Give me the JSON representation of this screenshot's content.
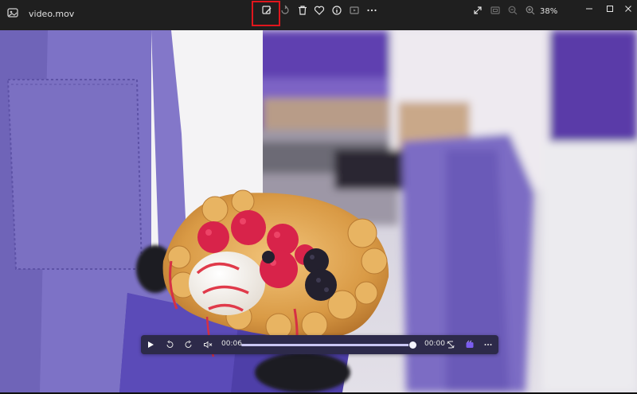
{
  "window": {
    "title": "video.mov",
    "zoom_level": "38%"
  },
  "toolbar": {
    "items": [
      {
        "name": "edit-icon",
        "highlighted": true
      },
      {
        "name": "rotate-icon"
      },
      {
        "name": "delete-icon"
      },
      {
        "name": "favorite-icon"
      },
      {
        "name": "info-icon"
      },
      {
        "name": "slideshow-icon"
      },
      {
        "name": "more-icon"
      }
    ],
    "view_items": [
      {
        "name": "fullscreen-icon"
      },
      {
        "name": "fit-icon"
      },
      {
        "name": "zoom-out-icon"
      },
      {
        "name": "zoom-in-icon"
      }
    ]
  },
  "player": {
    "current_time": "00:06",
    "end_time": "00:00",
    "progress": 1.0
  },
  "colors": {
    "highlight": "#e0161d",
    "controls_bg": "#2d2a4a",
    "seek_fill": "#c9c6f2"
  }
}
